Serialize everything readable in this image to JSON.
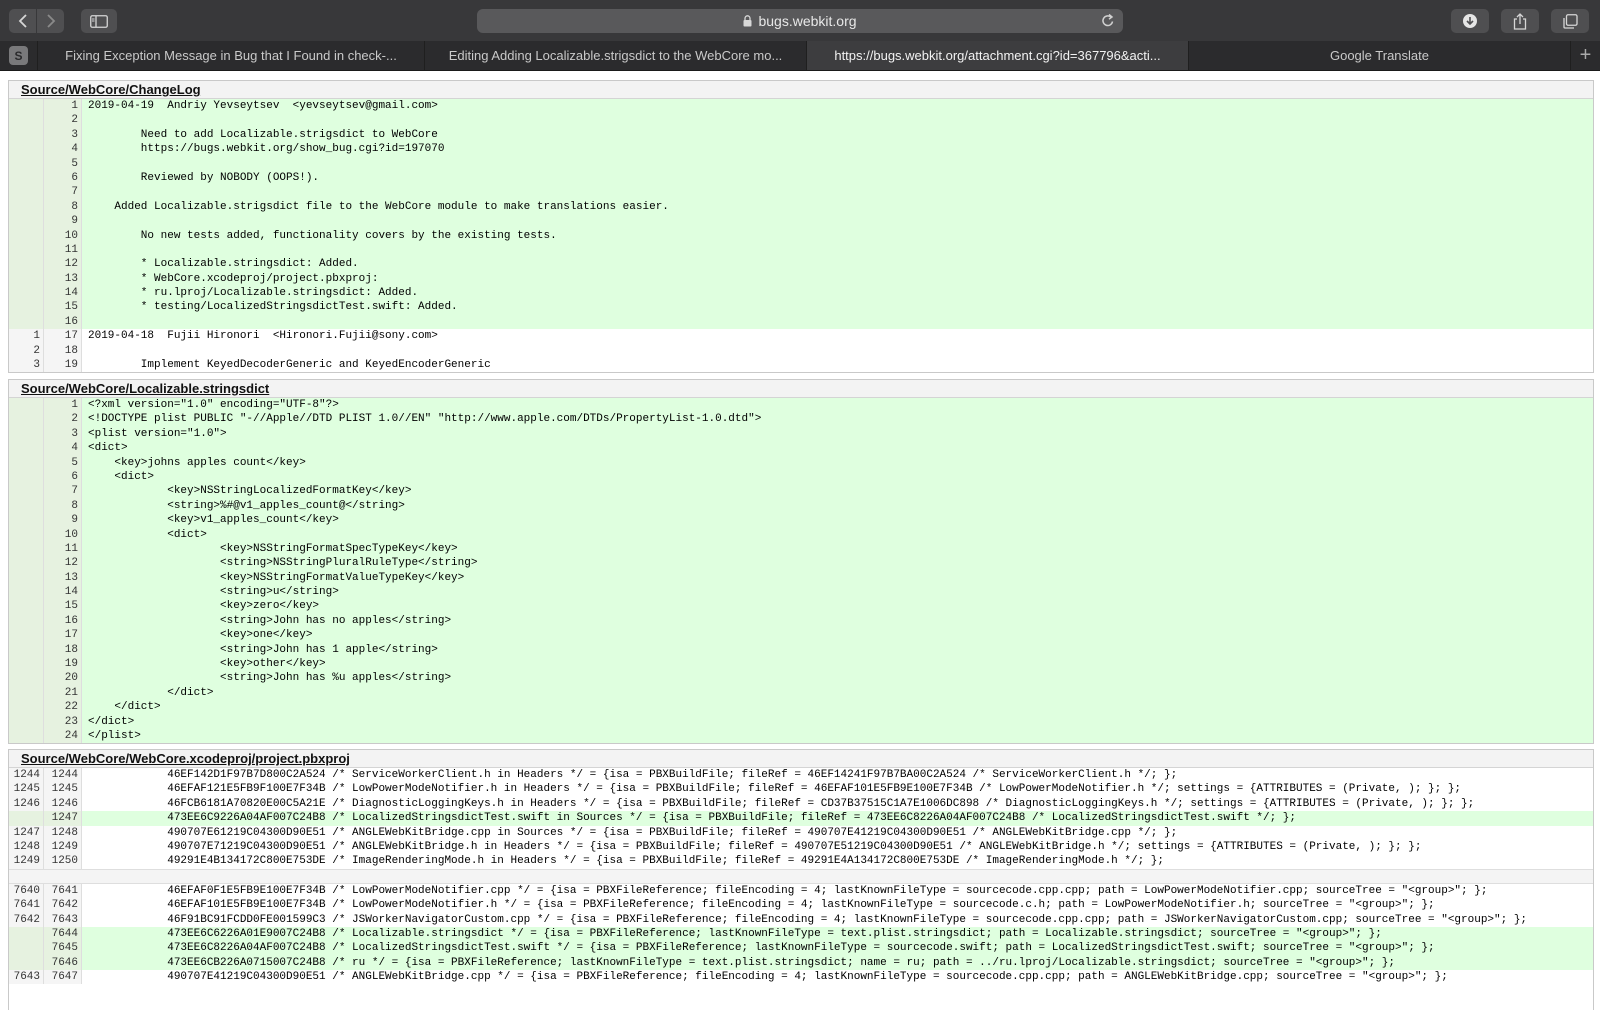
{
  "browser": {
    "url": "bugs.webkit.org",
    "favicon_letter": "S",
    "tabs": [
      {
        "title": "Fixing Exception Message in Bug that I Found in check-..."
      },
      {
        "title": "Editing Adding Localizable.strigsdict to the WebCore mo..."
      },
      {
        "title": "https://bugs.webkit.org/attachment.cgi?id=367796&acti..."
      },
      {
        "title": "Google Translate"
      }
    ],
    "icons": [
      "back-icon",
      "forward-icon",
      "sidebar-icon",
      "lock-icon",
      "reload-icon",
      "download-icon",
      "share-icon",
      "tabs-overview-icon",
      "new-tab-icon"
    ]
  },
  "files": [
    {
      "path": "Source/WebCore/ChangeLog",
      "rows": [
        {
          "o": "",
          "n": "1",
          "t": "2019-04-19  Andriy Yevseytsev  <yevseytsev@gmail.com>",
          "k": "add"
        },
        {
          "o": "",
          "n": "2",
          "t": "",
          "k": "add"
        },
        {
          "o": "",
          "n": "3",
          "t": "        Need to add Localizable.strigsdict to WebCore",
          "k": "add"
        },
        {
          "o": "",
          "n": "4",
          "t": "        https://bugs.webkit.org/show_bug.cgi?id=197070",
          "k": "add"
        },
        {
          "o": "",
          "n": "5",
          "t": "",
          "k": "add"
        },
        {
          "o": "",
          "n": "6",
          "t": "        Reviewed by NOBODY (OOPS!).",
          "k": "add"
        },
        {
          "o": "",
          "n": "7",
          "t": "",
          "k": "add"
        },
        {
          "o": "",
          "n": "8",
          "t": "    Added Localizable.strigsdict file to the WebCore module to make translations easier.",
          "k": "add"
        },
        {
          "o": "",
          "n": "9",
          "t": "",
          "k": "add"
        },
        {
          "o": "",
          "n": "10",
          "t": "        No new tests added, functionality covers by the existing tests.",
          "k": "add"
        },
        {
          "o": "",
          "n": "11",
          "t": "",
          "k": "add"
        },
        {
          "o": "",
          "n": "12",
          "t": "        * Localizable.stringsdict: Added.",
          "k": "add"
        },
        {
          "o": "",
          "n": "13",
          "t": "        * WebCore.xcodeproj/project.pbxproj:",
          "k": "add"
        },
        {
          "o": "",
          "n": "14",
          "t": "        * ru.lproj/Localizable.stringsdict: Added.",
          "k": "add"
        },
        {
          "o": "",
          "n": "15",
          "t": "        * testing/LocalizedStringsdictTest.swift: Added.",
          "k": "add"
        },
        {
          "o": "",
          "n": "16",
          "t": "",
          "k": "add"
        },
        {
          "o": "1",
          "n": "17",
          "t": "2019-04-18  Fujii Hironori  <Hironori.Fujii@sony.com>",
          "k": "ctx"
        },
        {
          "o": "2",
          "n": "18",
          "t": "",
          "k": "ctx"
        },
        {
          "o": "3",
          "n": "19",
          "t": "        Implement KeyedDecoderGeneric and KeyedEncoderGeneric",
          "k": "ctx"
        }
      ]
    },
    {
      "path": "Source/WebCore/Localizable.stringsdict",
      "rows": [
        {
          "o": "",
          "n": "1",
          "t": "<?xml version=\"1.0\" encoding=\"UTF-8\"?>",
          "k": "add"
        },
        {
          "o": "",
          "n": "2",
          "t": "<!DOCTYPE plist PUBLIC \"-//Apple//DTD PLIST 1.0//EN\" \"http://www.apple.com/DTDs/PropertyList-1.0.dtd\">",
          "k": "add"
        },
        {
          "o": "",
          "n": "3",
          "t": "<plist version=\"1.0\">",
          "k": "add"
        },
        {
          "o": "",
          "n": "4",
          "t": "<dict>",
          "k": "add"
        },
        {
          "o": "",
          "n": "5",
          "t": "    <key>johns apples count</key>",
          "k": "add"
        },
        {
          "o": "",
          "n": "6",
          "t": "    <dict>",
          "k": "add"
        },
        {
          "o": "",
          "n": "7",
          "t": "            <key>NSStringLocalizedFormatKey</key>",
          "k": "add"
        },
        {
          "o": "",
          "n": "8",
          "t": "            <string>%#@v1_apples_count@</string>",
          "k": "add"
        },
        {
          "o": "",
          "n": "9",
          "t": "            <key>v1_apples_count</key>",
          "k": "add"
        },
        {
          "o": "",
          "n": "10",
          "t": "            <dict>",
          "k": "add"
        },
        {
          "o": "",
          "n": "11",
          "t": "                    <key>NSStringFormatSpecTypeKey</key>",
          "k": "add"
        },
        {
          "o": "",
          "n": "12",
          "t": "                    <string>NSStringPluralRuleType</string>",
          "k": "add"
        },
        {
          "o": "",
          "n": "13",
          "t": "                    <key>NSStringFormatValueTypeKey</key>",
          "k": "add"
        },
        {
          "o": "",
          "n": "14",
          "t": "                    <string>u</string>",
          "k": "add"
        },
        {
          "o": "",
          "n": "15",
          "t": "                    <key>zero</key>",
          "k": "add"
        },
        {
          "o": "",
          "n": "16",
          "t": "                    <string>John has no apples</string>",
          "k": "add"
        },
        {
          "o": "",
          "n": "17",
          "t": "                    <key>one</key>",
          "k": "add"
        },
        {
          "o": "",
          "n": "18",
          "t": "                    <string>John has 1 apple</string>",
          "k": "add"
        },
        {
          "o": "",
          "n": "19",
          "t": "                    <key>other</key>",
          "k": "add"
        },
        {
          "o": "",
          "n": "20",
          "t": "                    <string>John has %u apples</string>",
          "k": "add"
        },
        {
          "o": "",
          "n": "21",
          "t": "            </dict>",
          "k": "add"
        },
        {
          "o": "",
          "n": "22",
          "t": "    </dict>",
          "k": "add"
        },
        {
          "o": "",
          "n": "23",
          "t": "</dict>",
          "k": "add"
        },
        {
          "o": "",
          "n": "24",
          "t": "</plist>",
          "k": "add"
        }
      ]
    },
    {
      "path": "Source/WebCore/WebCore.xcodeproj/project.pbxproj",
      "rows": [
        {
          "o": "1244",
          "n": "1244",
          "t": "            46EF142D1F97B7D800C2A524 /* ServiceWorkerClient.h in Headers */ = {isa = PBXBuildFile; fileRef = 46EF14241F97B7BA00C2A524 /* ServiceWorkerClient.h */; };",
          "k": "ctx"
        },
        {
          "o": "1245",
          "n": "1245",
          "t": "            46EFAF121E5FB9F100E7F34B /* LowPowerModeNotifier.h in Headers */ = {isa = PBXBuildFile; fileRef = 46EFAF101E5FB9E100E7F34B /* LowPowerModeNotifier.h */; settings = {ATTRIBUTES = (Private, ); }; };",
          "k": "ctx"
        },
        {
          "o": "1246",
          "n": "1246",
          "t": "            46FCB6181A70820E00C5A21E /* DiagnosticLoggingKeys.h in Headers */ = {isa = PBXBuildFile; fileRef = CD37B37515C1A7E1006DC898 /* DiagnosticLoggingKeys.h */; settings = {ATTRIBUTES = (Private, ); }; };",
          "k": "ctx"
        },
        {
          "o": "",
          "n": "1247",
          "t": "            473EE6C9226A04AF007C24B8 /* LocalizedStringsdictTest.swift in Sources */ = {isa = PBXBuildFile; fileRef = 473EE6C8226A04AF007C24B8 /* LocalizedStringsdictTest.swift */; };",
          "k": "add"
        },
        {
          "o": "1247",
          "n": "1248",
          "t": "            490707E61219C04300D90E51 /* ANGLEWebKitBridge.cpp in Sources */ = {isa = PBXBuildFile; fileRef = 490707E41219C04300D90E51 /* ANGLEWebKitBridge.cpp */; };",
          "k": "ctx"
        },
        {
          "o": "1248",
          "n": "1249",
          "t": "            490707E71219C04300D90E51 /* ANGLEWebKitBridge.h in Headers */ = {isa = PBXBuildFile; fileRef = 490707E51219C04300D90E51 /* ANGLEWebKitBridge.h */; settings = {ATTRIBUTES = (Private, ); }; };",
          "k": "ctx"
        },
        {
          "o": "1249",
          "n": "1250",
          "t": "            49291E4B134172C800E753DE /* ImageRenderingMode.h in Headers */ = {isa = PBXBuildFile; fileRef = 49291E4A134172C800E753DE /* ImageRenderingMode.h */; };",
          "k": "ctx"
        },
        {
          "gap": true
        },
        {
          "o": "7640",
          "n": "7641",
          "t": "            46EFAF0F1E5FB9E100E7F34B /* LowPowerModeNotifier.cpp */ = {isa = PBXFileReference; fileEncoding = 4; lastKnownFileType = sourcecode.cpp.cpp; path = LowPowerModeNotifier.cpp; sourceTree = \"<group>\"; };",
          "k": "ctx"
        },
        {
          "o": "7641",
          "n": "7642",
          "t": "            46EFAF101E5FB9E100E7F34B /* LowPowerModeNotifier.h */ = {isa = PBXFileReference; fileEncoding = 4; lastKnownFileType = sourcecode.c.h; path = LowPowerModeNotifier.h; sourceTree = \"<group>\"; };",
          "k": "ctx"
        },
        {
          "o": "7642",
          "n": "7643",
          "t": "            46F91BC91FCDD0FE001599C3 /* JSWorkerNavigatorCustom.cpp */ = {isa = PBXFileReference; fileEncoding = 4; lastKnownFileType = sourcecode.cpp.cpp; path = JSWorkerNavigatorCustom.cpp; sourceTree = \"<group>\"; };",
          "k": "ctx"
        },
        {
          "o": "",
          "n": "7644",
          "t": "            473EE6C6226A01E9007C24B8 /* Localizable.stringsdict */ = {isa = PBXFileReference; lastKnownFileType = text.plist.stringsdict; path = Localizable.stringsdict; sourceTree = \"<group>\"; };",
          "k": "add"
        },
        {
          "o": "",
          "n": "7645",
          "t": "            473EE6C8226A04AF007C24B8 /* LocalizedStringsdictTest.swift */ = {isa = PBXFileReference; lastKnownFileType = sourcecode.swift; path = LocalizedStringsdictTest.swift; sourceTree = \"<group>\"; };",
          "k": "add"
        },
        {
          "o": "",
          "n": "7646",
          "t": "            473EE6CB226A0715007C24B8 /* ru */ = {isa = PBXFileReference; lastKnownFileType = text.plist.stringsdict; name = ru; path = ../ru.lproj/Localizable.stringsdict; sourceTree = \"<group>\"; };",
          "k": "add"
        },
        {
          "o": "7643",
          "n": "7647",
          "t": "            490707E41219C04300D90E51 /* ANGLEWebKitBridge.cpp */ = {isa = PBXFileReference; fileEncoding = 4; lastKnownFileType = sourcecode.cpp.cpp; path = ANGLEWebKitBridge.cpp; sourceTree = \"<group>\"; };",
          "k": "ctx"
        }
      ]
    }
  ]
}
